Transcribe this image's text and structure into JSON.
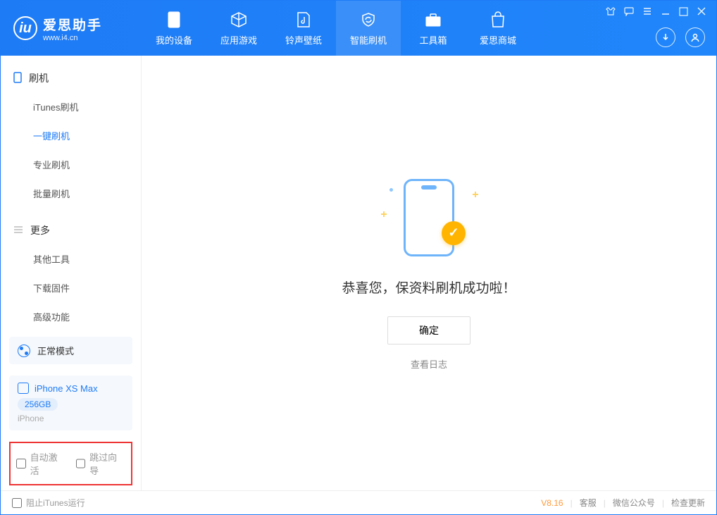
{
  "app": {
    "title": "爱思助手",
    "subtitle": "www.i4.cn"
  },
  "nav": {
    "items": [
      {
        "label": "我的设备"
      },
      {
        "label": "应用游戏"
      },
      {
        "label": "铃声壁纸"
      },
      {
        "label": "智能刷机"
      },
      {
        "label": "工具箱"
      },
      {
        "label": "爱思商城"
      }
    ]
  },
  "sidebar": {
    "section1_title": "刷机",
    "section1_items": [
      {
        "label": "iTunes刷机"
      },
      {
        "label": "一键刷机"
      },
      {
        "label": "专业刷机"
      },
      {
        "label": "批量刷机"
      }
    ],
    "section2_title": "更多",
    "section2_items": [
      {
        "label": "其他工具"
      },
      {
        "label": "下载固件"
      },
      {
        "label": "高级功能"
      }
    ],
    "mode": "正常模式",
    "device_name": "iPhone XS Max",
    "device_capacity": "256GB",
    "device_type": "iPhone",
    "checkbox1": "自动激活",
    "checkbox2": "跳过向导"
  },
  "main": {
    "title": "恭喜您，保资料刷机成功啦！",
    "ok_button": "确定",
    "view_log": "查看日志"
  },
  "footer": {
    "block_itunes": "阻止iTunes运行",
    "version": "V8.16",
    "link1": "客服",
    "link2": "微信公众号",
    "link3": "检查更新"
  }
}
